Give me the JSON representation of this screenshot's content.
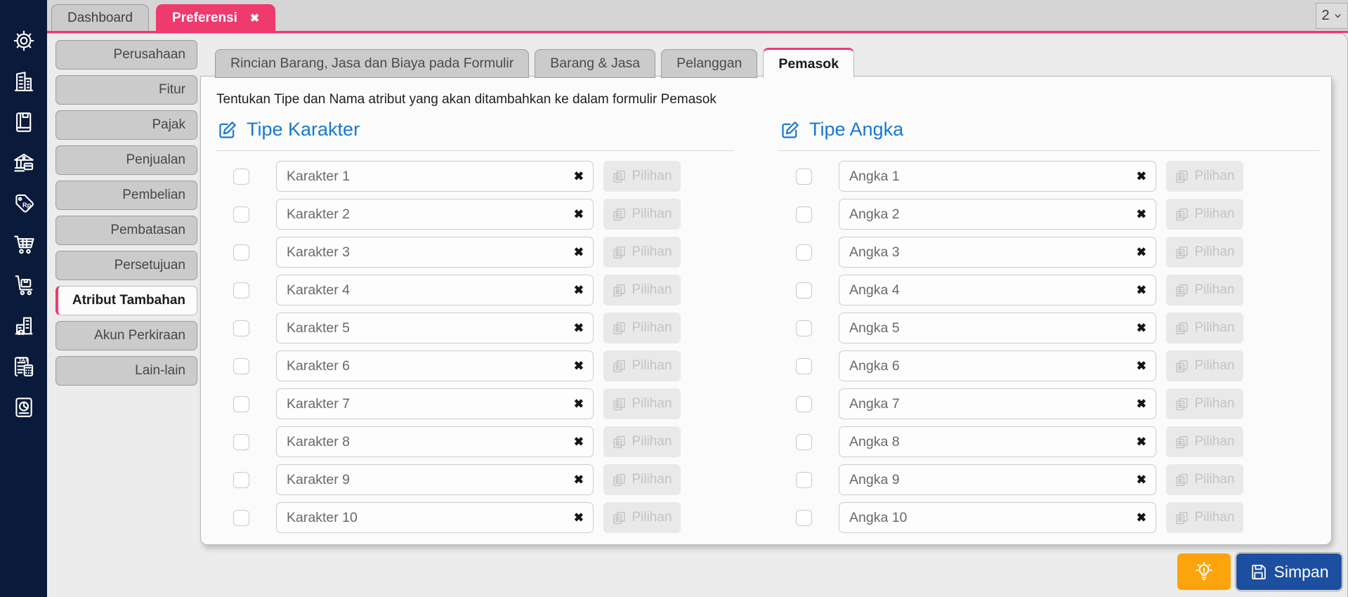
{
  "topbar": {
    "tabs": [
      {
        "label": "Dashboard",
        "active": false
      },
      {
        "label": "Preferensi",
        "active": true
      }
    ],
    "close_icon": "✖",
    "window_count": "2"
  },
  "sidebar": {
    "icons": [
      "settings-gear",
      "company-building",
      "journal-book",
      "bank",
      "price-tag-rp",
      "shopping-cart",
      "delivery-trolley",
      "asset-building",
      "tax-document",
      "report-pie"
    ]
  },
  "side_tabs": {
    "items": [
      {
        "label": "Perusahaan",
        "active": false
      },
      {
        "label": "Fitur",
        "active": false
      },
      {
        "label": "Pajak",
        "active": false
      },
      {
        "label": "Penjualan",
        "active": false
      },
      {
        "label": "Pembelian",
        "active": false
      },
      {
        "label": "Pembatasan",
        "active": false
      },
      {
        "label": "Persetujuan",
        "active": false
      },
      {
        "label": "Atribut Tambahan",
        "active": true
      },
      {
        "label": "Akun Perkiraan",
        "active": false
      },
      {
        "label": "Lain-lain",
        "active": false
      }
    ]
  },
  "content": {
    "form_tabs": [
      {
        "label": "Rincian Barang, Jasa dan Biaya pada Formulir",
        "active": false
      },
      {
        "label": "Barang & Jasa",
        "active": false
      },
      {
        "label": "Pelanggan",
        "active": false
      },
      {
        "label": "Pemasok",
        "active": true
      }
    ],
    "description": "Tentukan Tipe dan Nama atribut yang akan ditambahkan ke dalam formulir Pemasok",
    "clear_icon": "✖",
    "row_button_label": "Pilihan",
    "columns": [
      {
        "title": "Tipe Karakter",
        "rows": [
          "Karakter 1",
          "Karakter 2",
          "Karakter 3",
          "Karakter 4",
          "Karakter 5",
          "Karakter 6",
          "Karakter 7",
          "Karakter 8",
          "Karakter 9",
          "Karakter 10"
        ]
      },
      {
        "title": "Tipe Angka",
        "rows": [
          "Angka 1",
          "Angka 2",
          "Angka 3",
          "Angka 4",
          "Angka 5",
          "Angka 6",
          "Angka 7",
          "Angka 8",
          "Angka 9",
          "Angka 10"
        ]
      }
    ]
  },
  "footer": {
    "save_label": "Simpan"
  },
  "colors": {
    "accent_pink": "#ee3a6d",
    "sidebar_navy": "#0a1a3a",
    "heading_blue": "#1878d2",
    "save_blue": "#1d4fa1",
    "hint_orange": "#fca40e"
  }
}
